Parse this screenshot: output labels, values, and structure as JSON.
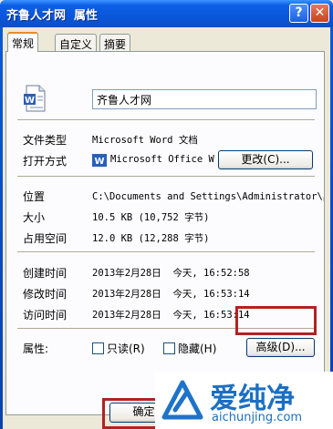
{
  "window": {
    "title": "齐鲁人才网  属性",
    "help_glyph": "?",
    "close_glyph": "✕"
  },
  "tabs": [
    {
      "label": "常规",
      "active": true
    },
    {
      "label": "自定义",
      "active": false
    },
    {
      "label": "摘要",
      "active": false
    }
  ],
  "general": {
    "file_name": "齐鲁人才网",
    "file_type_label": "文件类型",
    "file_type_value": "Microsoft Word 文档",
    "opens_with_label": "打开方式",
    "opens_with_value": "Microsoft Office Wo",
    "change_button": "更改(C)...",
    "location_label": "位置",
    "location_value": "C:\\Documents and Settings\\Administrator\\桌",
    "size_label": "大小",
    "size_value": "10.5 KB (10,752 字节)",
    "disk_size_label": "占用空间",
    "disk_size_value": "12.0 KB (12,288 字节)",
    "created_label": "创建时间",
    "created_value": "2013年2月28日  今天, 16:52:58",
    "modified_label": "修改时间",
    "modified_value": "2013年2月28日  今天, 16:53:14",
    "accessed_label": "访问时间",
    "accessed_value": "2013年2月28日  今天, 16:53:14",
    "attributes_label": "属性:",
    "readonly_label": "只读(R)",
    "hidden_label": "隐藏(H)",
    "advanced_button": "高级(D)..."
  },
  "footer": {
    "ok_button": "确定"
  },
  "watermark": {
    "brand": "爱纯净",
    "url": "aichunjing.com"
  },
  "colors": {
    "titlebar": "#0a54d6",
    "highlight_box": "#b22222",
    "tab_accent": "#e68b2c"
  }
}
